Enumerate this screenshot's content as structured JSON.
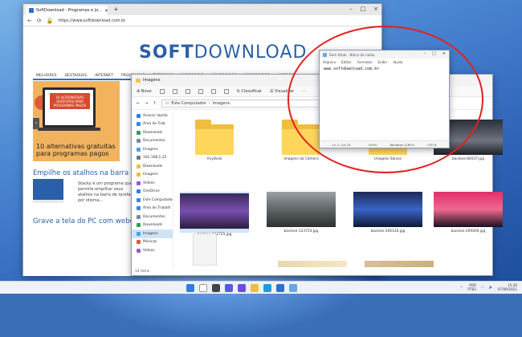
{
  "edge": {
    "tab_title": "SoftDownload - Programas e jo...",
    "url": "https://www.softdownload.com.br",
    "logo_soft": "SOFT",
    "logo_download": "DOWNLOAD",
    "nav": [
      "MELHORES",
      "DESTAQUES",
      "INTERNET",
      "PROGRAMAS",
      "TUTORIAIS",
      "WINDOWS 7",
      "WINDOWS 10",
      "WINDOWS 11",
      "ANDROID"
    ],
    "hero_banner": "10 ALTERNATIVAS GRATUITAS PARA PROGRAMAS PAGOS",
    "article_title": "10 alternativas gratuitas para programas pagos",
    "heading_1": "Empilhe os atalhos na barra de ta",
    "stacky_text": "Stacky é um programa que permite empilhar seus atalhos na barra de tarefas por idioma...",
    "heading_2": "Grave a tela do PC com webcam"
  },
  "explorer": {
    "title": "Imagens",
    "toolbar": [
      "Novo",
      "Classificar",
      "Visualizar"
    ],
    "breadcrumb": [
      "Este Computador",
      "Imagens"
    ],
    "sidebar": [
      {
        "label": "Acesso rápido",
        "color": "#2f7fd8"
      },
      {
        "label": "Área de Trab",
        "color": "#3a86e0"
      },
      {
        "label": "Downloads",
        "color": "#2aa05a"
      },
      {
        "label": "Documentos",
        "color": "#7a8aa0"
      },
      {
        "label": "Imagens",
        "color": "#4aa0e8"
      },
      {
        "label": "192.168.1.25",
        "color": "#777"
      },
      {
        "label": "Downloads",
        "color": "#f0bd3f"
      },
      {
        "label": "Imagens",
        "color": "#f0bd3f"
      },
      {
        "label": "Vídeos",
        "color": "#9a5ad0"
      },
      {
        "label": "OneDrive",
        "color": "#2f7fd8"
      },
      {
        "label": "Este Computador",
        "color": "#3a86e0"
      },
      {
        "label": "Área de Trabalh",
        "color": "#3a86e0"
      },
      {
        "label": "Documentos",
        "color": "#7a8aa0"
      },
      {
        "label": "Downloads",
        "color": "#2aa05a"
      },
      {
        "label": "Imagens",
        "color": "#4aa0e8"
      },
      {
        "label": "Músicas",
        "color": "#e05a3a"
      },
      {
        "label": "Vídeos",
        "color": "#9a5ad0"
      }
    ],
    "status": "14 itens",
    "items": [
      {
        "label": "AnyDesk"
      },
      {
        "label": "Imagens da Câmera"
      },
      {
        "label": "Imagens Salvas"
      },
      {
        "label": "backiee-84037.jpg"
      },
      {
        "label": "backiee-112725.jpg"
      },
      {
        "label": "backiee-123754.jpg"
      },
      {
        "label": "backiee-206126.jpg"
      },
      {
        "label": "backiee-209400.jpg"
      }
    ]
  },
  "notepad": {
    "title": "Sem título - Bloco de notas",
    "menu": [
      "Arquivo",
      "Editar",
      "Formatar",
      "Exibir",
      "Ajuda"
    ],
    "content": "www.softdownload.com.br",
    "status": [
      "Ln 1, Col 24",
      "100%",
      "Windows (CRLF)",
      "UTF-8"
    ]
  },
  "taskbar": {
    "lang": "POR",
    "lang2": "PTB2",
    "time": "15:26",
    "date": "07/09/2021"
  }
}
